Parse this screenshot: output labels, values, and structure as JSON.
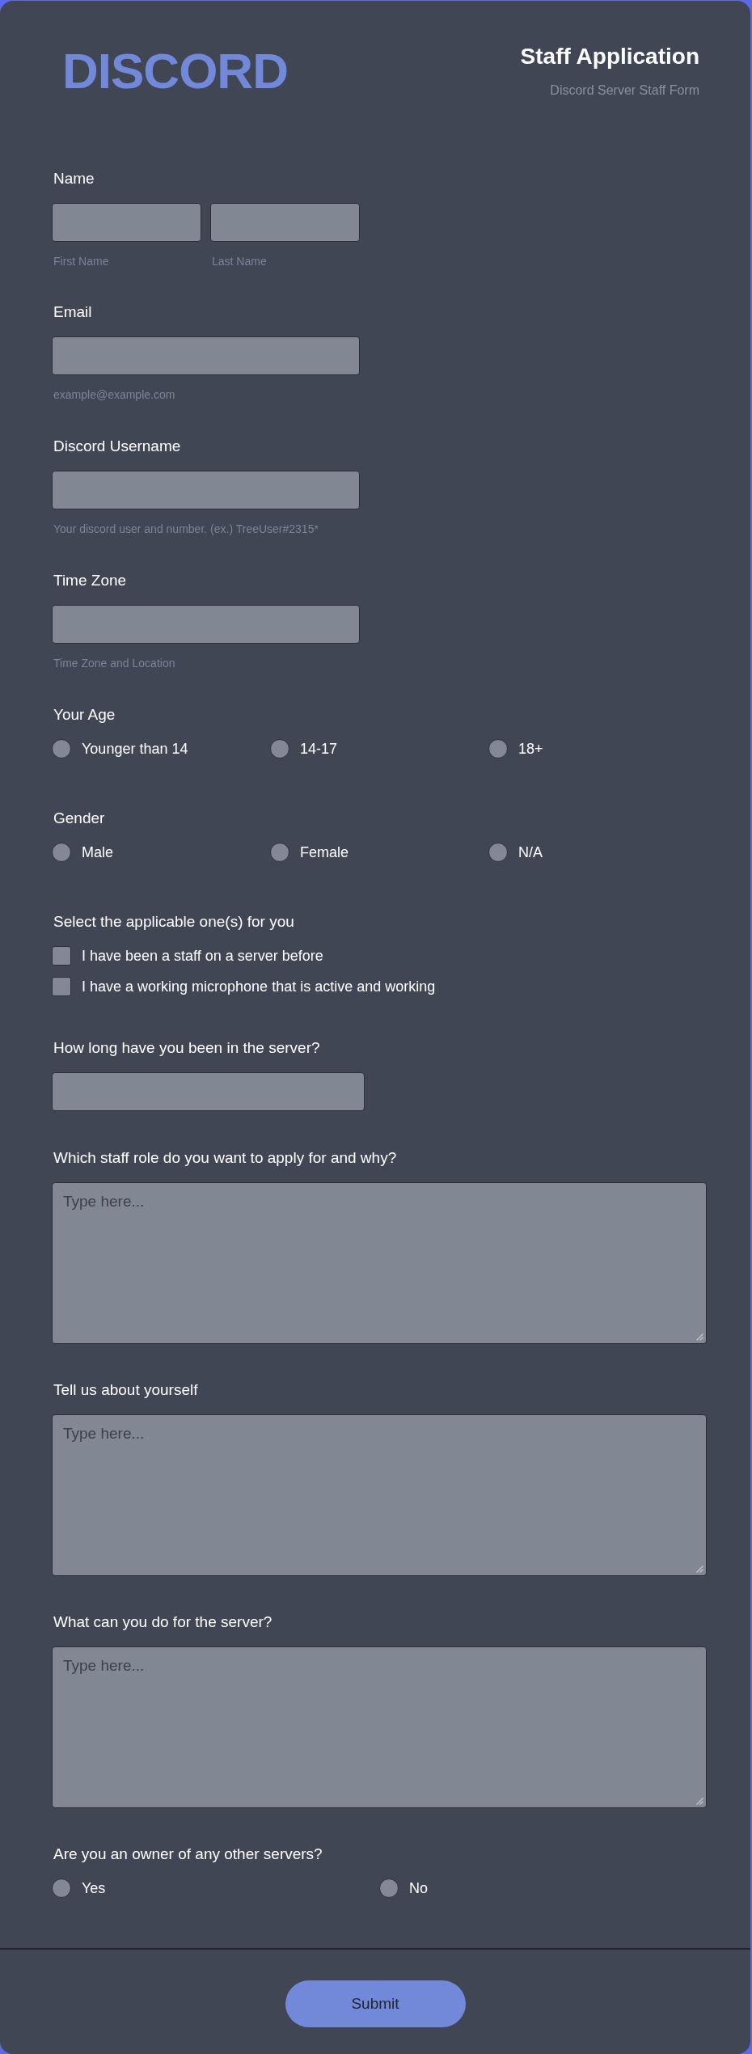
{
  "header": {
    "logo": "DISCORD",
    "title": "Staff Application",
    "subtitle": "Discord Server Staff Form"
  },
  "fields": [
    {
      "kind": "name",
      "label": "Name",
      "inputs": [
        {
          "hint": "First Name"
        },
        {
          "hint": "Last Name"
        }
      ]
    },
    {
      "kind": "text",
      "label": "Email",
      "hint": "example@example.com"
    },
    {
      "kind": "text",
      "label": "Discord Username",
      "hint": "Your discord user and number. (ex.) TreeUser#2315*"
    },
    {
      "kind": "text",
      "label": "Time Zone",
      "hint": "Time Zone and Location"
    },
    {
      "kind": "radio",
      "label": "Your Age",
      "options": [
        {
          "label": "Younger than 14",
          "selected": false
        },
        {
          "label": "14-17",
          "selected": false
        },
        {
          "label": "18+",
          "selected": false
        }
      ]
    },
    {
      "kind": "radio",
      "label": "Gender",
      "options": [
        {
          "label": "Male",
          "selected": false
        },
        {
          "label": "Female",
          "selected": false
        },
        {
          "label": "N/A",
          "selected": false
        }
      ]
    },
    {
      "kind": "checkbox",
      "label": "Select the applicable one(s) for you",
      "options": [
        {
          "label": "I have been a staff on a server before",
          "checked": false
        },
        {
          "label": "I have a working microphone that is active and working",
          "checked": false
        }
      ]
    },
    {
      "kind": "text",
      "label": "How long have you been in the server?"
    },
    {
      "kind": "textarea",
      "label": "Which staff role do you want to apply for and why?",
      "placeholder": "Type here..."
    },
    {
      "kind": "textarea",
      "label": "Tell us about yourself",
      "placeholder": "Type here..."
    },
    {
      "kind": "textarea",
      "label": "What can you do for the server?",
      "placeholder": "Type here..."
    },
    {
      "kind": "radio",
      "label": "Are you an owner of any other servers?",
      "options": [
        {
          "label": "Yes",
          "selected": false
        },
        {
          "label": "No",
          "selected": false
        }
      ]
    }
  ],
  "submit": "Submit"
}
